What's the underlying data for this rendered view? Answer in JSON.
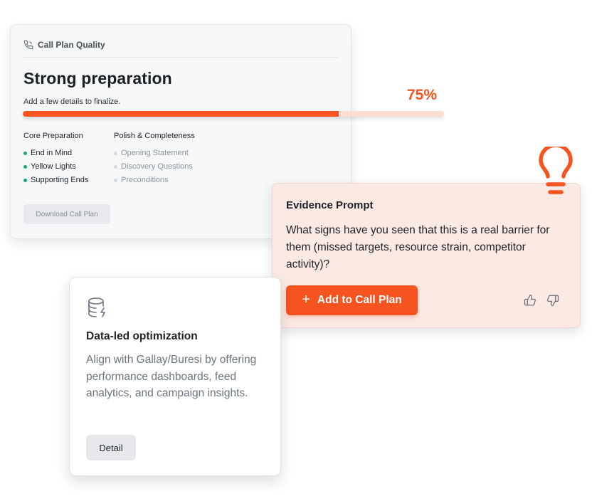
{
  "call_plan_quality": {
    "header_label": "Call Plan Quality",
    "title": "Strong preparation",
    "subtitle": "Add a few details to finalize.",
    "progress_percent": 75,
    "progress_label": "75%",
    "core_preparation": {
      "title": "Core Preparation",
      "items": [
        "End in Mind",
        "Yellow Lights",
        "Supporting Ends"
      ],
      "dot_color": "#17a673"
    },
    "polish_completeness": {
      "title": "Polish & Completeness",
      "items": [
        "Opening Statement",
        "Discovery Questions",
        "Preconditions"
      ],
      "dot_color": "#d7dadf"
    },
    "download_button": "Download Call Plan",
    "icon": "phone-icon"
  },
  "evidence_prompt": {
    "title": "Evidence Prompt",
    "body": "What signs have you seen that this is a real barrier for them (missed targets, resource strain, competitor activity)?",
    "add_button": "Add to Call Plan",
    "icons": [
      "plus-icon",
      "thumbs-up-icon",
      "thumbs-down-icon",
      "lightbulb-icon"
    ]
  },
  "data_led": {
    "icon": "database-bolt-icon",
    "title": "Data-led optimization",
    "description": "Align with Gallay/Buresi by offering performance dashboards, feed analytics, and campaign insights.",
    "detail_button": "Detail"
  },
  "colors": {
    "accent": "#f5531f",
    "progress_track": "#fbddd3",
    "evidence_bg": "#fbe9e4",
    "success_dot": "#17a673"
  }
}
